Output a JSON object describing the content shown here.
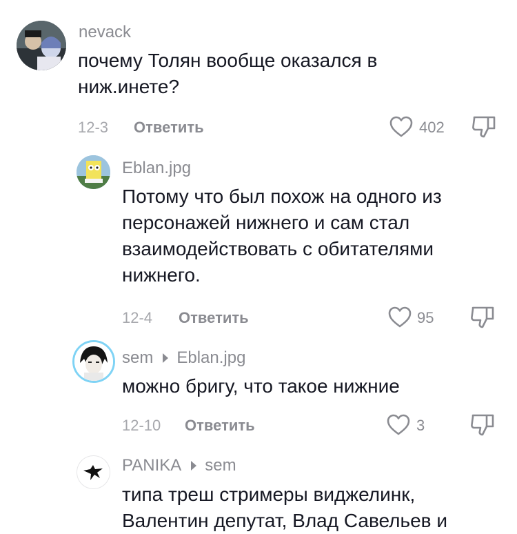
{
  "comments": [
    {
      "username": "nevack",
      "text": "почему Толян вообще оказался в ниж.инете?",
      "date": "12-3",
      "reply_label": "Ответить",
      "likes": "402"
    },
    {
      "username": "Eblan.jpg",
      "text": "Потому что был похож на одного из персонажей нижнего и сам стал взаимодействовать с обитателями нижнего.",
      "date": "12-4",
      "reply_label": "Ответить",
      "likes": "95"
    },
    {
      "username": "sem",
      "reply_to": "Eblan.jpg",
      "text": "можно бригу, что такое нижние",
      "date": "12-10",
      "reply_label": "Ответить",
      "likes": "3"
    },
    {
      "username": "PANIKA",
      "reply_to": "sem",
      "text": "типа треш стримеры виджелинк, Валентин депутат, Влад Савельев и"
    }
  ],
  "colors": {
    "text": "#161823",
    "muted": "#8a8b91",
    "date": "#a7a8ad",
    "avatar_ring": "#7fd3f5"
  },
  "icons": {
    "like": "heart-outline-icon",
    "dislike": "thumbs-down-outline-icon",
    "reply_arrow": "triangle-right-icon"
  }
}
